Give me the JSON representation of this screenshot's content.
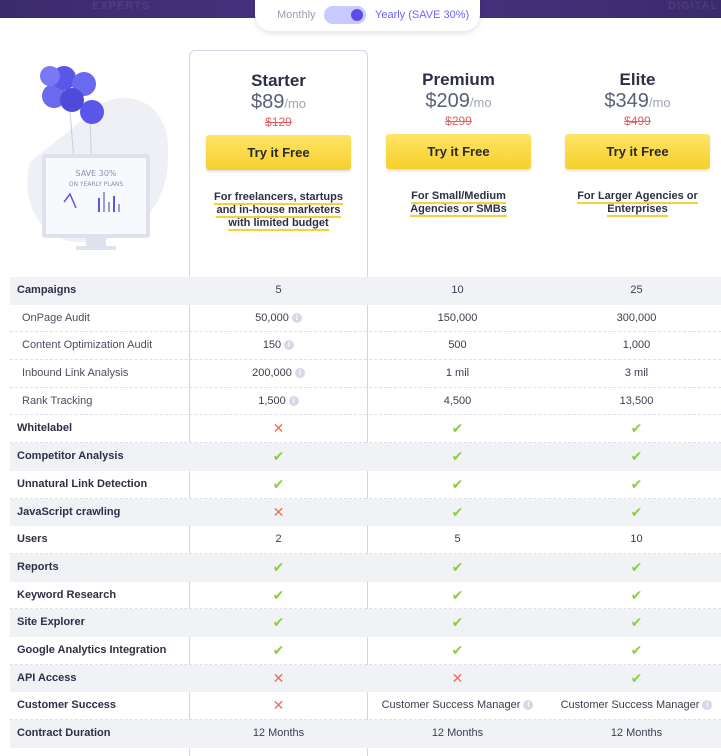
{
  "banner": {
    "words": [
      "EXPERTS",
      "DIGITAL"
    ]
  },
  "toggle": {
    "monthly": "Monthly",
    "yearly": "Yearly (SAVE 30%)"
  },
  "illustration": {
    "line1": "SAVE 30%",
    "line2": "ON YEARLY PLANS"
  },
  "plans": [
    {
      "name": "Starter",
      "price": "$89",
      "per": "/mo",
      "old": "$129",
      "cta": "Try it Free",
      "desc": "For freelancers, startups and in-house marketers with limited budget"
    },
    {
      "name": "Premium",
      "price": "$209",
      "per": "/mo",
      "old": "$299",
      "cta": "Try it Free",
      "desc": "For Small/Medium Agencies or SMBs"
    },
    {
      "name": "Elite",
      "price": "$349",
      "per": "/mo",
      "old": "$499",
      "cta": "Try it Free",
      "desc": "For Larger Agencies or Enterprises"
    }
  ],
  "colors": {
    "check": "#8ccf3e",
    "cross": "#ec6e5b",
    "cta": "#f7cf2c",
    "accent": "#6c63ff"
  },
  "features": [
    {
      "label": "Campaigns",
      "sub": false,
      "values": [
        "5",
        "10",
        "25"
      ]
    },
    {
      "label": "OnPage Audit",
      "sub": true,
      "values": [
        "50,000",
        "150,000",
        "300,000"
      ],
      "info": [
        true,
        false,
        false
      ]
    },
    {
      "label": "Content Optimization Audit",
      "sub": true,
      "values": [
        "150",
        "500",
        "1,000"
      ],
      "info": [
        true,
        false,
        false
      ]
    },
    {
      "label": "Inbound Link Analysis",
      "sub": true,
      "values": [
        "200,000",
        "1 mil",
        "3 mil"
      ],
      "info": [
        true,
        false,
        false
      ]
    },
    {
      "label": "Rank Tracking",
      "sub": true,
      "values": [
        "1,500",
        "4,500",
        "13,500"
      ],
      "info": [
        true,
        false,
        false
      ]
    },
    {
      "label": "Whitelabel",
      "sub": false,
      "values": [
        "cross",
        "check",
        "check"
      ]
    },
    {
      "label": "Competitor Analysis",
      "sub": false,
      "values": [
        "check",
        "check",
        "check"
      ]
    },
    {
      "label": "Unnatural Link Detection",
      "sub": false,
      "values": [
        "check",
        "check",
        "check"
      ]
    },
    {
      "label": "JavaScript crawling",
      "sub": false,
      "values": [
        "cross",
        "check",
        "check"
      ]
    },
    {
      "label": "Users",
      "sub": false,
      "values": [
        "2",
        "5",
        "10"
      ]
    },
    {
      "label": "Reports",
      "sub": false,
      "values": [
        "check",
        "check",
        "check"
      ]
    },
    {
      "label": "Keyword Research",
      "sub": false,
      "values": [
        "check",
        "check",
        "check"
      ]
    },
    {
      "label": "Site Explorer",
      "sub": false,
      "values": [
        "check",
        "check",
        "check"
      ]
    },
    {
      "label": "Google Analytics Integration",
      "sub": false,
      "values": [
        "check",
        "check",
        "check"
      ]
    },
    {
      "label": "API Access",
      "sub": false,
      "values": [
        "cross",
        "cross",
        "check"
      ]
    },
    {
      "label": "Customer Success",
      "sub": false,
      "values": [
        "cross",
        "Customer Success Manager",
        "Customer Success Manager"
      ],
      "info": [
        false,
        true,
        true
      ]
    },
    {
      "label": "Contract Duration",
      "sub": false,
      "values": [
        "12 Months",
        "12 Months",
        "12 Months"
      ]
    }
  ]
}
